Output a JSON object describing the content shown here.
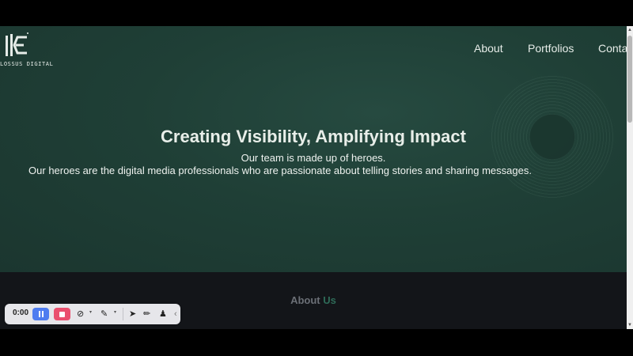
{
  "brand": {
    "logo_text": "LOSSUS DIGITAL"
  },
  "nav": {
    "items": [
      "About",
      "Portfolios",
      "Conta"
    ]
  },
  "hero": {
    "title": "Creating Visibility, Amplifying Impact",
    "subtitle_line1": "Our team is made up of heroes.",
    "subtitle_line2": "Our heroes are the digital media professionals who are passionate about telling stories and sharing messages."
  },
  "about": {
    "title_part1": "About",
    "title_part2": "Us"
  },
  "recorder": {
    "time": "0:00"
  },
  "colors": {
    "hero_bg": "#1f3f36",
    "about_bg": "#131519",
    "accent_green": "#2e6b58",
    "pause_blue": "#4e7cf0",
    "stop_red": "#ea4f6e"
  }
}
